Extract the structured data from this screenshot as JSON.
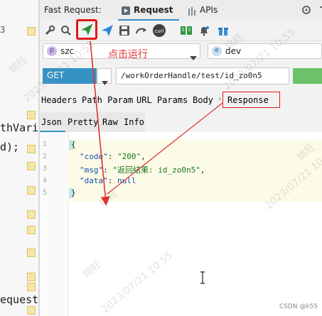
{
  "editor": {
    "fragments": [
      "3",
      "thVari",
      "d);",
      "equest"
    ]
  },
  "titlebar": {
    "app_label": "Fast Request:",
    "tab_request": "Request",
    "tab_apis": "APIs"
  },
  "toolbar": {
    "curl_label": "curl"
  },
  "project_combo": {
    "value": "szc",
    "badge": "p"
  },
  "env_combo": {
    "value": "dev",
    "badge": "e"
  },
  "annotation": {
    "text": "点击运行",
    "color": "#e03030"
  },
  "request": {
    "method": "GET",
    "url": "/workOrderHandle/test/id_zo0n5"
  },
  "tabs_primary": [
    "Headers",
    "Path Param",
    "URL Params",
    "Body",
    "Response"
  ],
  "tabs_primary_active": "Response",
  "tabs_secondary": [
    "Json",
    "Pretty",
    "Raw",
    "Info"
  ],
  "tabs_secondary_active": "Json",
  "response": {
    "line_numbers": [
      "1",
      "2",
      "3",
      "4",
      "5"
    ],
    "lines": {
      "l1": "{",
      "l2_key": "\"code\"",
      "l2_sep": ": ",
      "l2_val": "\"200\"",
      "l2_end": ",",
      "l3_key": "\"msg\"",
      "l3_sep": ": ",
      "l3_val": "\"返回结果: id_zo0n5\"",
      "l3_end": ",",
      "l4_key": "\"data\"",
      "l4_sep": ": ",
      "l4_val": "null",
      "l5": "}"
    }
  },
  "watermarks": [
    "姚旺",
    "2023/07/21 10:55"
  ],
  "credit": "CSDN @k55",
  "colors": {
    "accent_blue": "#3592c4",
    "run_green": "#2e9a3e",
    "highlight_red": "#e03030"
  }
}
